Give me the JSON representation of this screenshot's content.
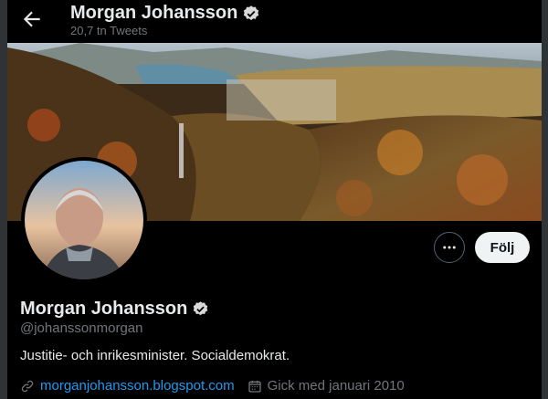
{
  "header": {
    "name": "Morgan Johansson",
    "tweet_count": "20,7 tn Tweets"
  },
  "actions": {
    "follow_label": "Följ"
  },
  "profile": {
    "name": "Morgan Johansson",
    "handle": "@johanssonmorgan",
    "bio": "Justitie- och inrikesminister. Socialdemokrat.",
    "website": "morganjohansson.blogspot.com",
    "joined": "Gick med januari 2010"
  },
  "icons": {
    "back": "arrow-left-icon",
    "verified": "verified-badge-icon",
    "more": "more-dots-icon",
    "link": "link-icon",
    "calendar": "calendar-icon"
  },
  "colors": {
    "background": "#000000",
    "text": "#e7e9ea",
    "muted": "#71767b",
    "link": "#1d9bf0",
    "verified": "#d9d9d9",
    "follow_bg": "#eff3f4"
  }
}
